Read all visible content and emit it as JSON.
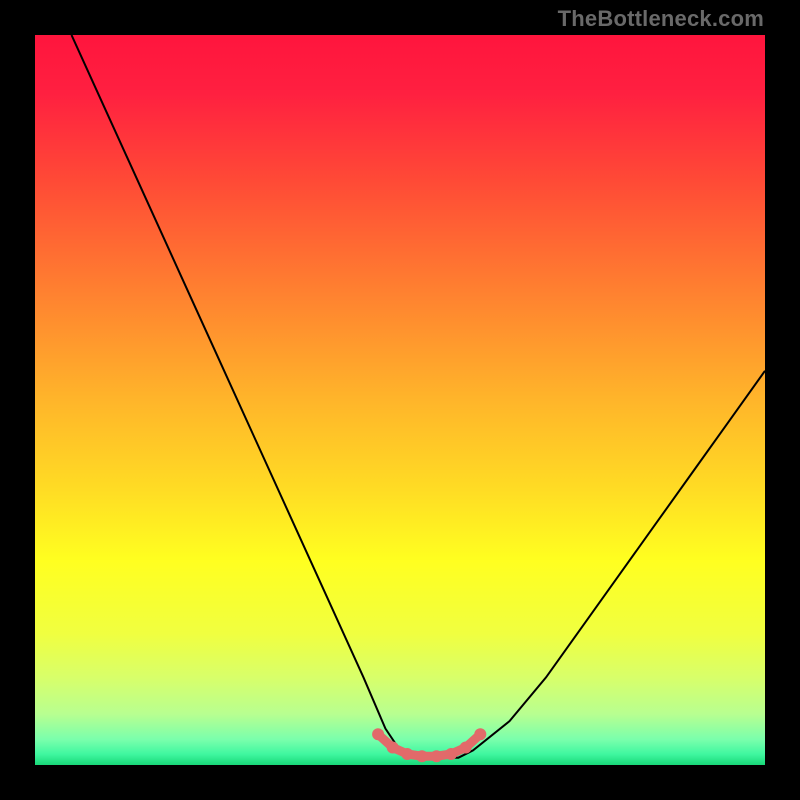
{
  "watermark": "TheBottleneck.com",
  "gradient": {
    "stops": [
      {
        "offset": 0.0,
        "color": "#ff153d"
      },
      {
        "offset": 0.08,
        "color": "#ff2040"
      },
      {
        "offset": 0.2,
        "color": "#ff4a36"
      },
      {
        "offset": 0.35,
        "color": "#ff8030"
      },
      {
        "offset": 0.5,
        "color": "#ffb52a"
      },
      {
        "offset": 0.62,
        "color": "#ffdb24"
      },
      {
        "offset": 0.72,
        "color": "#ffff20"
      },
      {
        "offset": 0.82,
        "color": "#f0ff40"
      },
      {
        "offset": 0.88,
        "color": "#d8ff6a"
      },
      {
        "offset": 0.93,
        "color": "#b8ff90"
      },
      {
        "offset": 0.965,
        "color": "#7affac"
      },
      {
        "offset": 0.985,
        "color": "#40f7a0"
      },
      {
        "offset": 1.0,
        "color": "#18d878"
      }
    ]
  },
  "chart_data": {
    "type": "line",
    "title": "",
    "xlabel": "",
    "ylabel": "",
    "xlim": [
      0,
      100
    ],
    "ylim": [
      0,
      100
    ],
    "series": [
      {
        "name": "bottleneck-curve",
        "x": [
          5,
          10,
          15,
          20,
          25,
          30,
          35,
          40,
          45,
          48,
          50,
          52,
          55,
          58,
          60,
          65,
          70,
          75,
          80,
          85,
          90,
          95,
          100
        ],
        "y": [
          100,
          89,
          78,
          67,
          56,
          45,
          34,
          23,
          12,
          5,
          2,
          1,
          1,
          1,
          2,
          6,
          12,
          19,
          26,
          33,
          40,
          47,
          54
        ]
      }
    ],
    "markers": {
      "name": "optimal-range-dots",
      "color": "#e26a6a",
      "x": [
        47,
        49,
        51,
        53,
        55,
        57,
        59,
        61
      ],
      "y": [
        4.2,
        2.4,
        1.5,
        1.2,
        1.2,
        1.5,
        2.4,
        4.2
      ]
    }
  }
}
